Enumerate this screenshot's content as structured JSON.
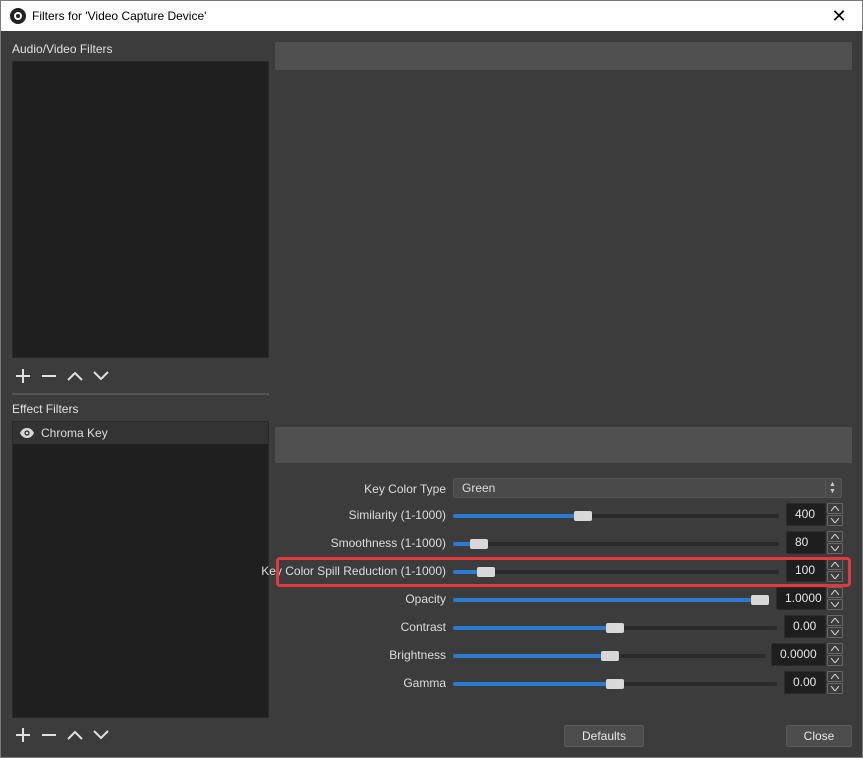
{
  "window": {
    "title": "Filters for 'Video Capture Device'",
    "close_glyph": "✕"
  },
  "audio_video_filters": {
    "label": "Audio/Video Filters",
    "items": []
  },
  "effect_filters": {
    "label": "Effect Filters",
    "items": [
      {
        "name": "Chroma Key",
        "visible": true
      }
    ]
  },
  "toolbar": {
    "icons": [
      "add-icon",
      "remove-icon",
      "move-up-icon",
      "move-down-icon"
    ]
  },
  "properties": {
    "key_color_type": {
      "label": "Key Color Type",
      "value": "Green"
    },
    "similarity": {
      "label": "Similarity (1-1000)",
      "value": "400",
      "fraction": 0.4
    },
    "smoothness": {
      "label": "Smoothness (1-1000)",
      "value": "80",
      "fraction": 0.08
    },
    "spill_reduction": {
      "label": "Key Color Spill Reduction (1-1000)",
      "value": "100",
      "fraction": 0.1
    },
    "opacity": {
      "label": "Opacity",
      "value": "1.0000",
      "fraction": 1.0
    },
    "contrast": {
      "label": "Contrast",
      "value": "0.00",
      "fraction": 0.5
    },
    "brightness": {
      "label": "Brightness",
      "value": "0.0000",
      "fraction": 0.5
    },
    "gamma": {
      "label": "Gamma",
      "value": "0.00",
      "fraction": 0.5
    }
  },
  "buttons": {
    "defaults": "Defaults",
    "close": "Close"
  },
  "colors": {
    "accent": "#2b7bd0",
    "highlight": "#e0393e",
    "background": "#3c3c3c"
  }
}
